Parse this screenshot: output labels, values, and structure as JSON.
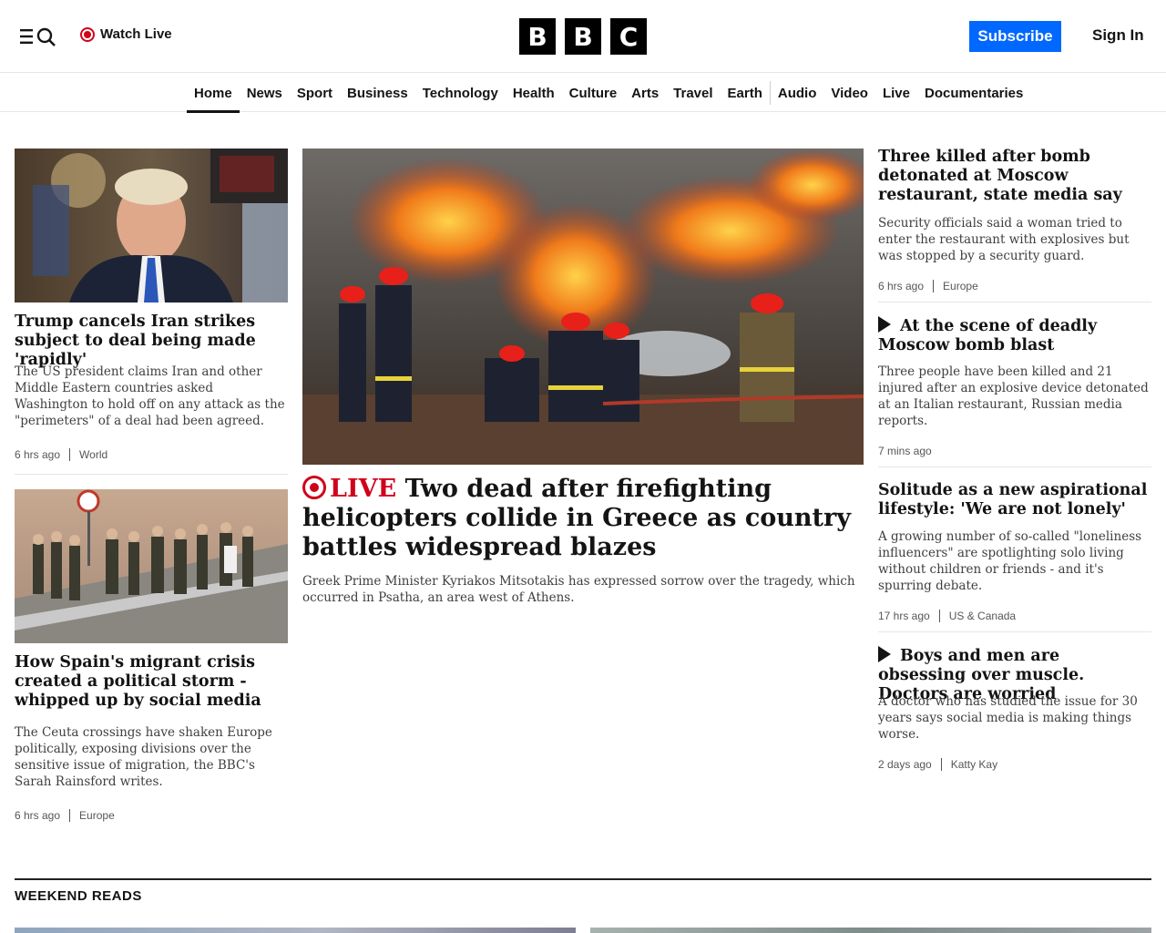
{
  "header": {
    "watch_live": "Watch Live",
    "logo_letters": [
      "B",
      "B",
      "C"
    ],
    "subscribe": "Subscribe",
    "sign_in": "Sign In"
  },
  "nav": {
    "items": [
      "Home",
      "News",
      "Sport",
      "Business",
      "Technology",
      "Health",
      "Culture",
      "Arts",
      "Travel",
      "Earth",
      "Audio",
      "Video",
      "Live",
      "Documentaries"
    ],
    "active": "Home"
  },
  "left": [
    {
      "headline": "Trump cancels Iran strikes subject to deal being made 'rapidly'",
      "summary": "The US president claims Iran and other Middle Eastern countries asked Washington to hold off on any attack as the \"perimeters\" of a deal had been agreed.",
      "time": "6 hrs ago",
      "section": "World"
    },
    {
      "headline": "How Spain's migrant crisis created a political storm - whipped up by social media",
      "summary": "The Ceuta crossings have shaken Europe politically, exposing divisions over the sensitive issue of migration, the BBC's Sarah Rainsford writes.",
      "time": "6 hrs ago",
      "section": "Europe"
    }
  ],
  "main": {
    "live_label": "LIVE",
    "headline": "Two dead after firefighting helicopters collide in Greece as country battles widespread blazes",
    "summary": "Greek Prime Minister Kyriakos Mitsotakis has expressed sorrow over the tragedy, which occurred in Psatha, an area west of Athens."
  },
  "right": [
    {
      "headline": "Three killed after bomb detonated at Moscow restaurant, state media say",
      "summary": "Security officials said a woman tried to enter the restaurant with explosives but was stopped by a security guard.",
      "time": "6 hrs ago",
      "section": "Europe"
    },
    {
      "headline": "At the scene of deadly Moscow bomb blast",
      "summary": "Three people have been killed and 21 injured after an explosive device detonated at an Italian restaurant, Russian media reports.",
      "time": "7 mins ago",
      "section": ""
    },
    {
      "headline": "Solitude as a new aspirational lifestyle: 'We are not lonely'",
      "summary": "A growing number of so-called \"loneliness influencers\" are spotlighting solo living without children or friends - and it's spurring debate.",
      "time": "17 hrs ago",
      "section": "US & Canada"
    },
    {
      "headline": "Boys and men are obsessing over muscle. Doctors are worried",
      "summary": "A doctor who has studied the issue for 30 years says social media is making things worse.",
      "time": "2 days ago",
      "section": "Katty Kay"
    }
  ],
  "weekend": {
    "title": "WEEKEND READS"
  },
  "icons": {
    "menu": "menu-icon",
    "search": "search-icon",
    "live": "live-icon",
    "play": "play-icon"
  },
  "colors": {
    "accent_blue": "#0068ff",
    "live_red": "#d0021b"
  }
}
